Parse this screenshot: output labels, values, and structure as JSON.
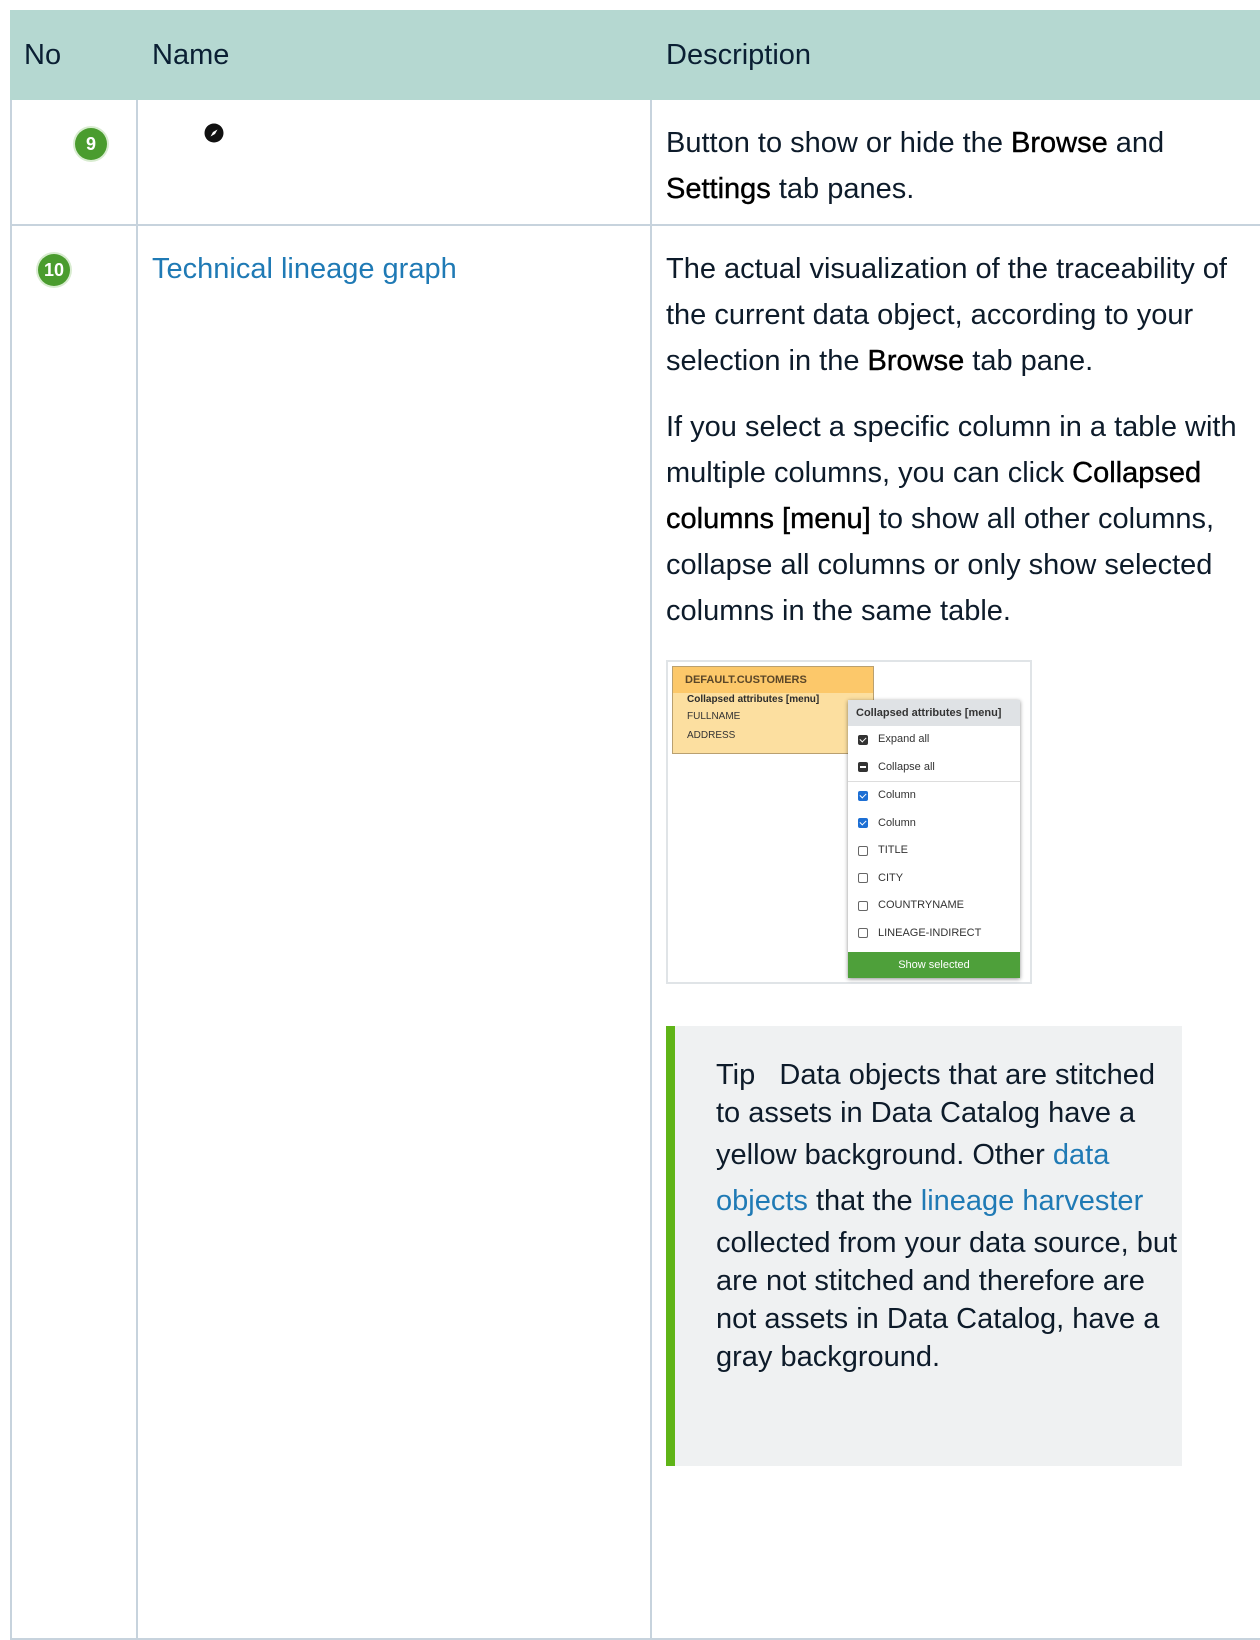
{
  "table": {
    "headers": {
      "no": "No",
      "name": "Name",
      "description": "Description"
    },
    "row9": {
      "no": "9",
      "icon": "compass-icon",
      "desc_before": "Button to show or hide the ",
      "desc_b1": "Browse",
      "desc_mid": " and ",
      "desc_b2": "Settings",
      "desc_after": " tab panes."
    },
    "row10": {
      "no": "10",
      "name": "Technical lineage graph",
      "p1_before": "The actual visualization of the traceability of the current data object, according to your selection in the ",
      "p1_b": "Browse",
      "p1_after": " tab pane.",
      "p2_before": "If you select a specific column in a table with multiple columns, you can click ",
      "p2_b": "Collapsed columns [menu]",
      "p2_after": " to show all other columns, collapse all columns or only show selected columns in the same table."
    }
  },
  "screenshot": {
    "entity_title": "DEFAULT.CUSTOMERS",
    "entity_sub": "Collapsed attributes [menu]",
    "entity_rows": [
      "FULLNAME",
      "ADDRESS"
    ],
    "menu_title": "Collapsed attributes [menu]",
    "menu_items": [
      "Expand all",
      "Collapse all",
      "Column",
      "Column",
      "TITLE",
      "CITY",
      "COUNTRYNAME",
      "LINEAGE-INDIRECT"
    ],
    "menu_button": "Show selected"
  },
  "tip": {
    "label": "Tip",
    "text1": "Data objects that are stitched to assets in Data Catalog have a yellow background. Other ",
    "link1": "data objects",
    "text2": " that the ",
    "link2": "lineage harvester",
    "text3": " collected from your data source, but are not stitched and therefore are not assets in Data Catalog, have a gray background."
  },
  "colors": {
    "header_bg": "#b5d8d1",
    "badge": "#4a9c2e",
    "link": "#1f7ab5",
    "tip_border": "#5fb417"
  }
}
